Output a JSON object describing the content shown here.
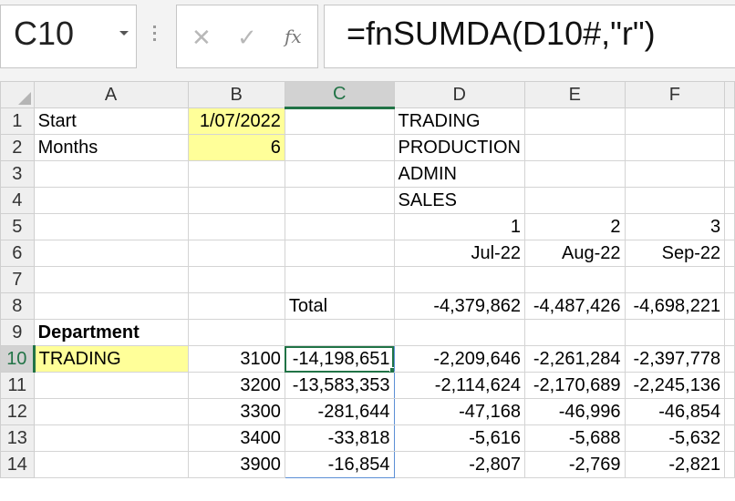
{
  "formula_bar": {
    "name_box": "C10",
    "formula": "=fnSUMDA(D10#,\"r\")",
    "icons": [
      "cancel-icon",
      "enter-icon",
      "fx-icon"
    ]
  },
  "columns": [
    "A",
    "B",
    "C",
    "D",
    "E",
    "F"
  ],
  "selected_column": "C",
  "selected_row": "10",
  "colors": {
    "selection": "#217346",
    "input_fill": "#ffff99",
    "spill_border": "#5b8fd6"
  },
  "rows": [
    {
      "n": "1",
      "A": "Start",
      "B": "1/07/2022",
      "C": "",
      "D": "TRADING",
      "E": "",
      "F": ""
    },
    {
      "n": "2",
      "A": "Months",
      "B": "6",
      "C": "",
      "D": "PRODUCTION",
      "E": "",
      "F": ""
    },
    {
      "n": "3",
      "A": "",
      "B": "",
      "C": "",
      "D": "ADMIN",
      "E": "",
      "F": ""
    },
    {
      "n": "4",
      "A": "",
      "B": "",
      "C": "",
      "D": "SALES",
      "E": "",
      "F": ""
    },
    {
      "n": "5",
      "A": "",
      "B": "",
      "C": "",
      "D": "1",
      "E": "2",
      "F": "3"
    },
    {
      "n": "6",
      "A": "",
      "B": "",
      "C": "",
      "D": "Jul-22",
      "E": "Aug-22",
      "F": "Sep-22"
    },
    {
      "n": "7",
      "A": "",
      "B": "",
      "C": "",
      "D": "",
      "E": "",
      "F": ""
    },
    {
      "n": "8",
      "A": "",
      "B": "",
      "C": "Total",
      "D": "-4,379,862",
      "E": "-4,487,426",
      "F": "-4,698,221"
    },
    {
      "n": "9",
      "A": "Department",
      "B": "",
      "C": "",
      "D": "",
      "E": "",
      "F": ""
    },
    {
      "n": "10",
      "A": "TRADING",
      "B": "3100",
      "C": "-14,198,651",
      "D": "-2,209,646",
      "E": "-2,261,284",
      "F": "-2,397,778"
    },
    {
      "n": "11",
      "A": "",
      "B": "3200",
      "C": "-13,583,353",
      "D": "-2,114,624",
      "E": "-2,170,689",
      "F": "-2,245,136"
    },
    {
      "n": "12",
      "A": "",
      "B": "3300",
      "C": "-281,644",
      "D": "-47,168",
      "E": "-46,996",
      "F": "-46,854"
    },
    {
      "n": "13",
      "A": "",
      "B": "3400",
      "C": "-33,818",
      "D": "-5,616",
      "E": "-5,688",
      "F": "-5,632"
    },
    {
      "n": "14",
      "A": "",
      "B": "3900",
      "C": "-16,854",
      "D": "-2,807",
      "E": "-2,769",
      "F": "-2,821"
    }
  ]
}
